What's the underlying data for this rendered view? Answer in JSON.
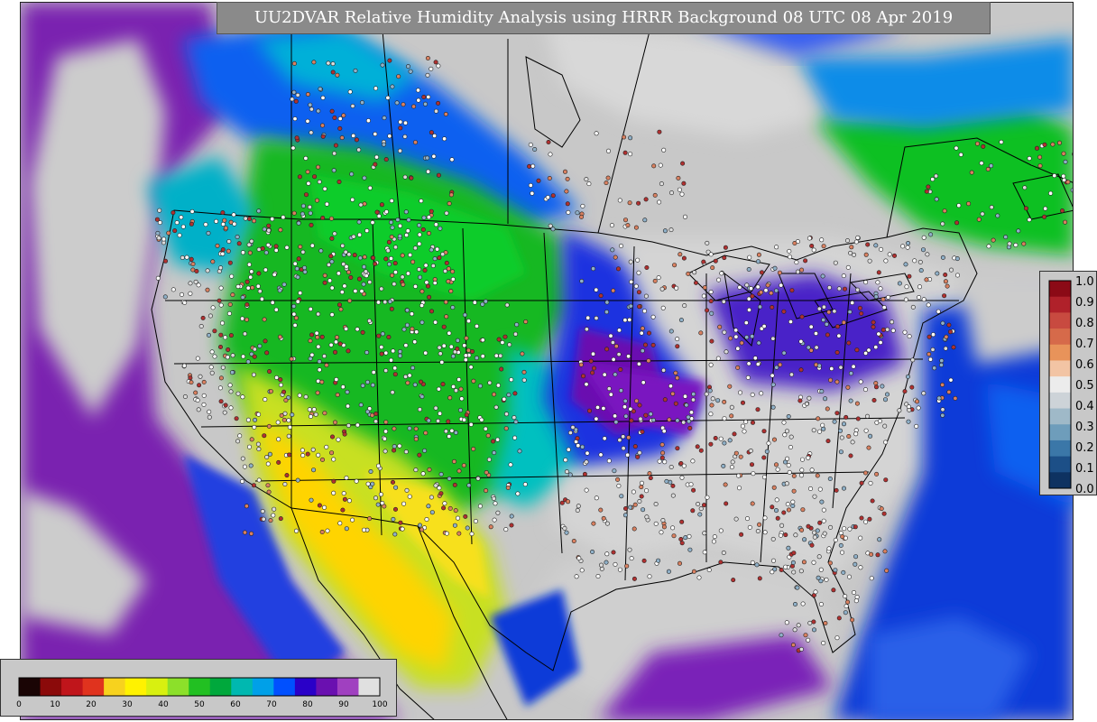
{
  "title": "UU2DVAR Relative Humidity Analysis using HRRR Background 08 UTC 08 Apr 2019",
  "right_colorbar": {
    "ticks": [
      "1.0",
      "0.9",
      "0.8",
      "0.7",
      "0.6",
      "0.5",
      "0.4",
      "0.3",
      "0.2",
      "0.1",
      "0.0"
    ],
    "colors": [
      "#8b0a16",
      "#b0212a",
      "#c84a40",
      "#d66a4a",
      "#e8935a",
      "#f2c4a4",
      "#ececec",
      "#cdd3d8",
      "#9fb9c8",
      "#6e9dbb",
      "#3b77a8",
      "#1c4f87",
      "#0e3261"
    ]
  },
  "bottom_colorbar": {
    "ticks": [
      "0",
      "10",
      "20",
      "30",
      "40",
      "50",
      "60",
      "70",
      "80",
      "90",
      "100"
    ],
    "colors": [
      "#1a0505",
      "#8b0a0a",
      "#c0151b",
      "#e0331e",
      "#f7d21e",
      "#fff200",
      "#d8f010",
      "#8ce02a",
      "#22c022",
      "#00a83c",
      "#00b8b0",
      "#00a0e8",
      "#0050ff",
      "#2a00c8",
      "#6a10b0",
      "#a040c0",
      "#e0e0e0"
    ]
  },
  "map": {
    "ocean_color": "#c8c8c8",
    "station_marker_color": "#ffffff"
  }
}
